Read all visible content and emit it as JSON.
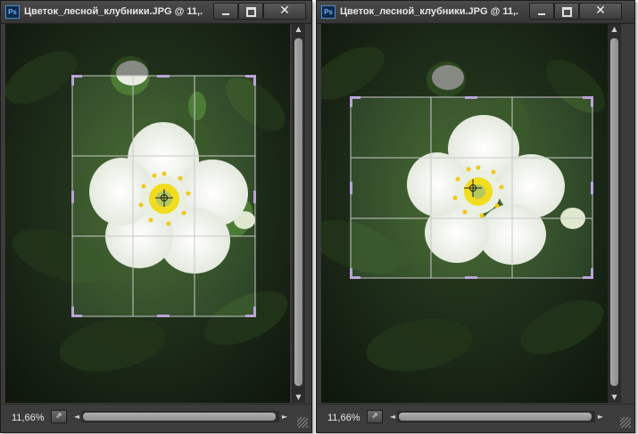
{
  "windows": [
    {
      "icon_text": "Ps",
      "title": "Цветок_лесной_клубники.JPG @ 11,...",
      "zoom": "11,66%"
    },
    {
      "icon_text": "Ps",
      "title": "Цветок_лесной_клубники.JPG @ 11,...",
      "zoom": "11,66%"
    }
  ],
  "controls": {
    "minimize_icon": "minimize-icon",
    "maximize_icon": "maximize-icon",
    "close_glyph": "✕",
    "share_glyph": "⇗",
    "scroll_up": "▲",
    "scroll_down": "▼",
    "scroll_left": "◄",
    "scroll_right": "►"
  },
  "colors": {
    "window_bg": "#3b3b3b",
    "crop_guides": "#c9c9c9",
    "crop_handles": "#b9a3da",
    "petal": "#f4f6f1",
    "stamen": "#f1dc1e"
  }
}
